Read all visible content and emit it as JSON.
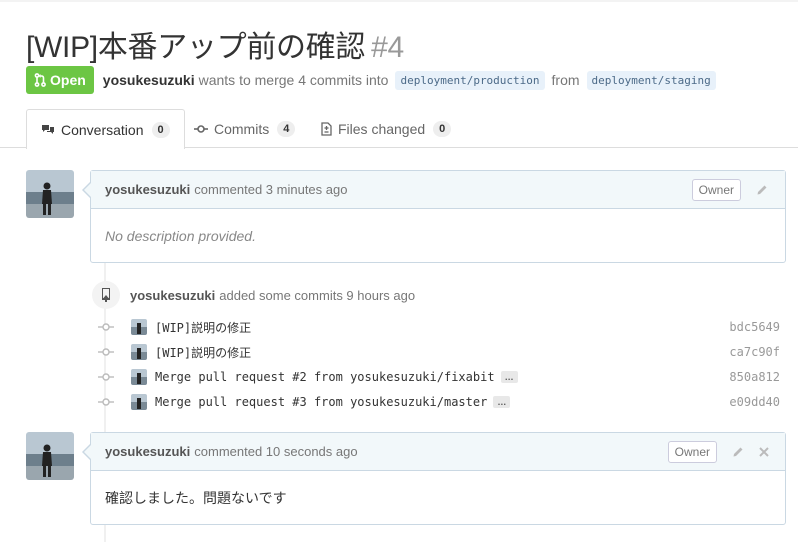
{
  "pull_request": {
    "title": "[WIP]本番アップ前の確認",
    "number": "#4",
    "state": "Open",
    "author": "yosukesuzuki",
    "merge_text": "wants to merge 4 commits into",
    "base_branch": "deployment/production",
    "from_text": "from",
    "head_branch": "deployment/staging"
  },
  "tabs": [
    {
      "label": "Conversation",
      "count": "0",
      "icon": "comment-discussion-icon"
    },
    {
      "label": "Commits",
      "count": "4",
      "icon": "git-commit-icon"
    },
    {
      "label": "Files changed",
      "count": "0",
      "icon": "diff-icon"
    }
  ],
  "comment1": {
    "author": "yosukesuzuki",
    "action": "commented 3 minutes ago",
    "role": "Owner",
    "body": "No description provided."
  },
  "commit_event": {
    "author": "yosukesuzuki",
    "action": "added some commits 9 hours ago"
  },
  "commits": [
    {
      "message": "[WIP]説明の修正",
      "sha": "bdc5649",
      "more": ""
    },
    {
      "message": "[WIP]説明の修正",
      "sha": "ca7c90f",
      "more": ""
    },
    {
      "message": "Merge pull request #2 from yosukesuzuki/fixabit",
      "sha": "850a812",
      "more": "…"
    },
    {
      "message": "Merge pull request #3 from yosukesuzuki/master",
      "sha": "e09dd40",
      "more": "…"
    }
  ],
  "comment2": {
    "author": "yosukesuzuki",
    "action": "commented 10 seconds ago",
    "role": "Owner",
    "body": "確認しました。問題ないです"
  },
  "colors": {
    "open_state": "#6cc644",
    "comment_header_bg": "#f2f8fa",
    "comment_border": "#cad8e3",
    "branch_bg": "#e8f1fa"
  }
}
